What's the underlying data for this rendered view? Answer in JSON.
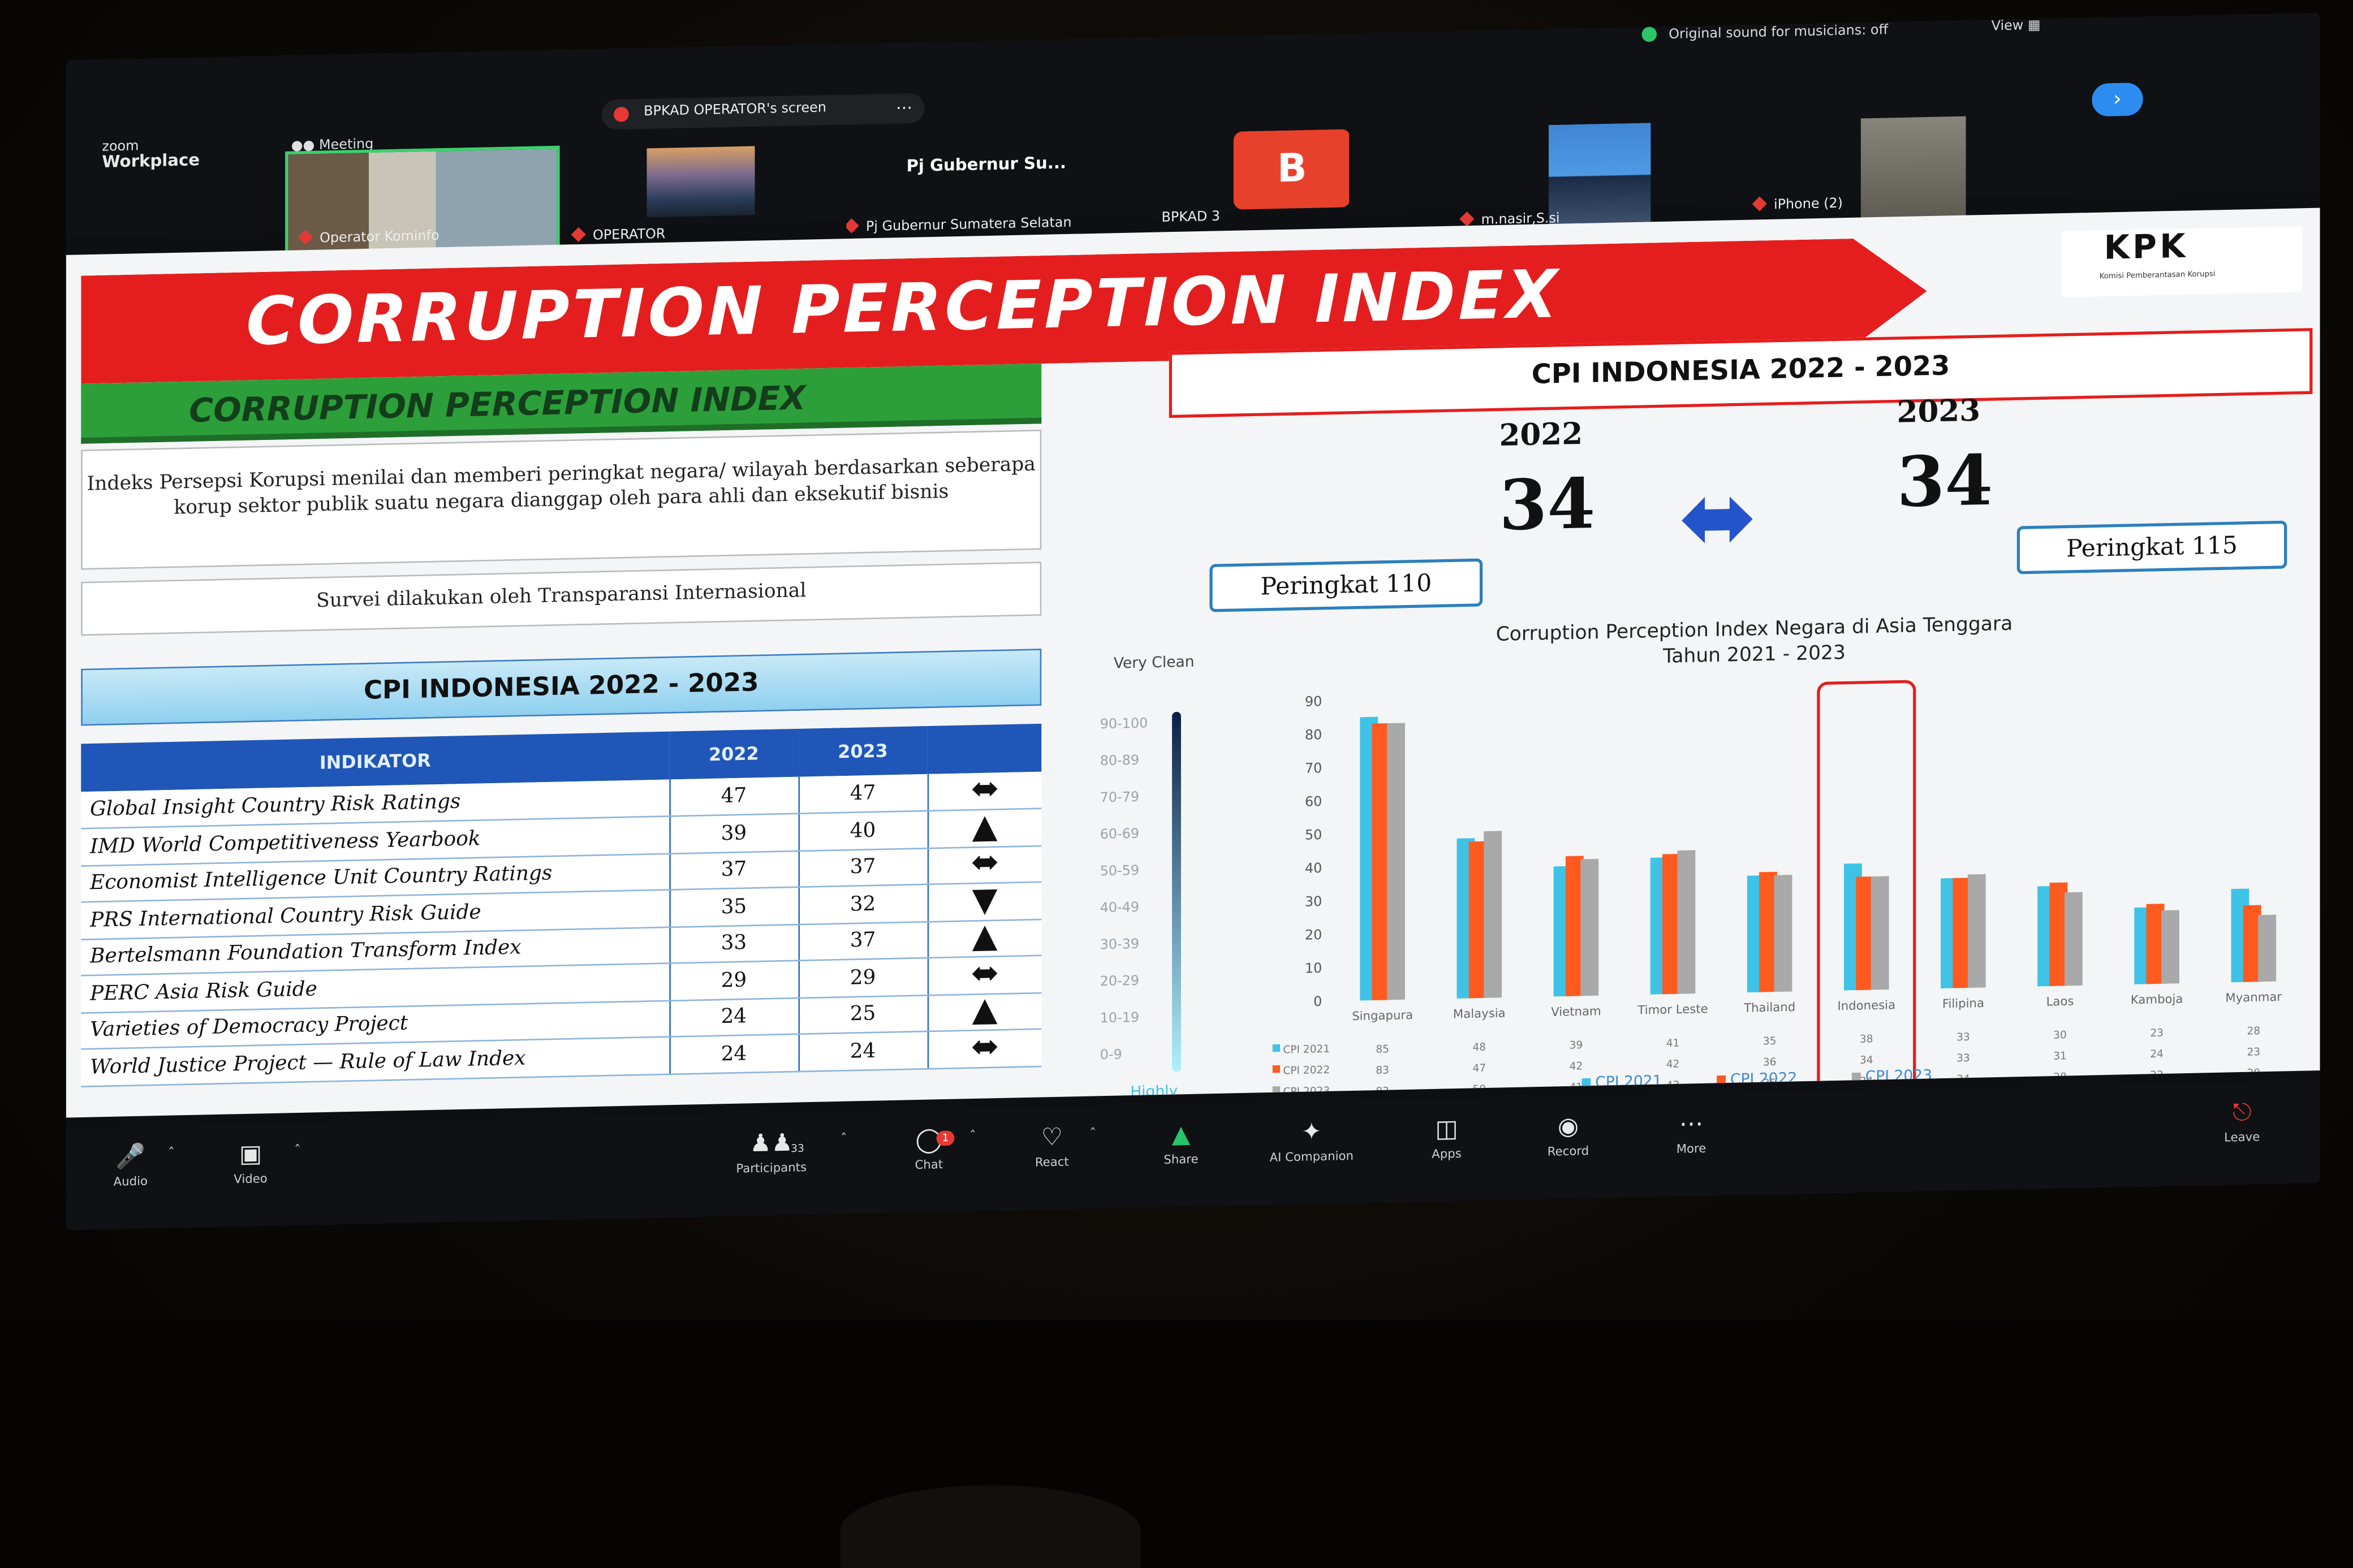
{
  "zoom": {
    "logo_small": "zoom",
    "logo": "Workplace",
    "meeting_label": "Meeting",
    "shared_screen_label": "BPKAD OPERATOR's screen",
    "original_sound": "Original sound for musicians: off",
    "view_label": "View",
    "participants_tiles": [
      {
        "name": "Operator Kominfo"
      },
      {
        "name": "OPERATOR"
      },
      {
        "name": "Pj Gubernur Su...",
        "subname": "Pj Gubernur Sumatera Selatan"
      },
      {
        "name": "BPKAD 3",
        "avatar": "B"
      },
      {
        "name": "m.nasir,S.si"
      },
      {
        "name": "iPhone (2)"
      }
    ],
    "controls": {
      "audio": "Audio",
      "video": "Video",
      "participants": "Participants",
      "participants_count": "33",
      "chat": "Chat",
      "chat_badge": "1",
      "react": "React",
      "share": "Share",
      "ai": "AI Companion",
      "apps": "Apps",
      "record": "Record",
      "more": "More",
      "leave": "Leave"
    }
  },
  "slide": {
    "banner_title": "CORRUPTION PERCEPTION INDEX",
    "logo_text": "KPK",
    "logo_sub": "Komisi Pemberantasan Korupsi",
    "green_title": "CORRUPTION PERCEPTION INDEX",
    "description": "Indeks Persepsi Korupsi menilai dan memberi peringkat negara/ wilayah berdasarkan seberapa korup sektor publik suatu negara dianggap oleh para ahli dan eksekutif bisnis",
    "survey": "Survei dilakukan oleh Transparansi Internasional",
    "table_title": "CPI INDONESIA 2022 - 2023",
    "table_headers": [
      "INDIKATOR",
      "2022",
      "2023"
    ],
    "table_rows": [
      {
        "name": "Global Insight Country Risk Ratings",
        "v2022": "47",
        "v2023": "47",
        "trend": "same"
      },
      {
        "name": "IMD World Competitiveness Yearbook",
        "v2022": "39",
        "v2023": "40",
        "trend": "up"
      },
      {
        "name": "Economist Intelligence Unit Country Ratings",
        "v2022": "37",
        "v2023": "37",
        "trend": "same"
      },
      {
        "name": "PRS International Country Risk Guide",
        "v2022": "35",
        "v2023": "32",
        "trend": "down"
      },
      {
        "name": "Bertelsmann Foundation Transform Index",
        "v2022": "33",
        "v2023": "37",
        "trend": "up"
      },
      {
        "name": "PERC Asia Risk Guide",
        "v2022": "29",
        "v2023": "29",
        "trend": "same"
      },
      {
        "name": "Varieties of Democracy Project",
        "v2022": "24",
        "v2023": "25",
        "trend": "up"
      },
      {
        "name": "World Justice Project — Rule of Law Index",
        "v2022": "24",
        "v2023": "24",
        "trend": "same"
      }
    ],
    "cpi_box_title": "CPI INDONESIA 2022 - 2023",
    "year_a": "2022",
    "year_b": "2023",
    "score_a": "34",
    "score_b": "34",
    "rank_a": "Peringkat 110",
    "rank_b": "Peringkat 115",
    "scale_top": "Very Clean",
    "scale_bottom": "Highly Corrupt",
    "scale_bands": [
      "90-100",
      "80-89",
      "70-79",
      "60-69",
      "50-59",
      "40-49",
      "30-39",
      "20-29",
      "10-19",
      "0-9"
    ]
  },
  "colors": {
    "cpi2021": "#3ec3e6",
    "cpi2022": "#ff5a1f",
    "cpi2023": "#a9a9a9",
    "red": "#e41e1e",
    "blue_arrow": "#2454c9"
  },
  "chart_data": {
    "type": "bar",
    "title": "Corruption Perception Index Negara di Asia Tenggara",
    "subtitle": "Tahun 2021 - 2023",
    "categories": [
      "Singapura",
      "Malaysia",
      "Vietnam",
      "Timor Leste",
      "Thailand",
      "Indonesia",
      "Filipina",
      "Laos",
      "Kamboja",
      "Myanmar"
    ],
    "series": [
      {
        "name": "CPI 2021",
        "values": [
          85,
          48,
          39,
          41,
          35,
          38,
          33,
          30,
          23,
          28
        ]
      },
      {
        "name": "CPI 2022",
        "values": [
          83,
          47,
          42,
          42,
          36,
          34,
          33,
          31,
          24,
          23
        ]
      },
      {
        "name": "CPI 2023",
        "values": [
          83,
          50,
          41,
          43,
          35,
          34,
          34,
          28,
          22,
          20
        ]
      }
    ],
    "ylim": [
      0,
      90
    ],
    "yticks": [
      0,
      10,
      20,
      30,
      40,
      50,
      60,
      70,
      80,
      90
    ],
    "highlight": "Indonesia",
    "legend": "bottom"
  }
}
